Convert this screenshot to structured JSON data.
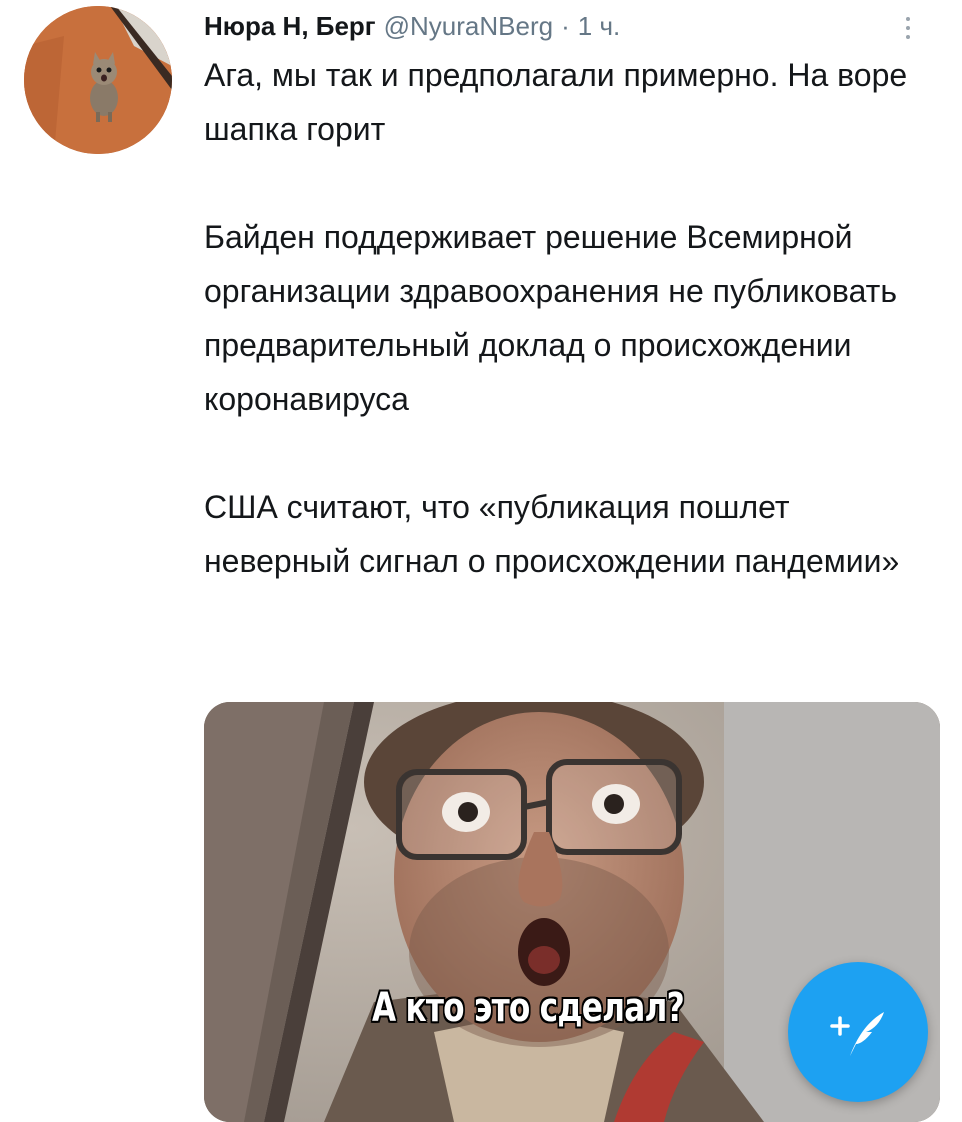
{
  "tweet": {
    "author_name": "Нюра Н, Берг",
    "author_handle": "@NyuraNBerg",
    "separator": "·",
    "time": "1 ч.",
    "paragraphs": [
      "Ага, мы так и предполагали примерно. На воре шапка горит",
      "Байден поддерживает решение Всемирной организации здравоохранения не публиковать предварительный доклад о происхождении коронавируса",
      "США считают, что «публикация пошлет неверный сигнал о происхождении пандемии»"
    ],
    "media_caption": "А кто это сделал?"
  },
  "icons": {
    "more": "more-vertical-icon",
    "compose": "compose-tweet-icon"
  },
  "colors": {
    "accent": "#1da1f2",
    "text": "#14171a",
    "muted": "#657786"
  }
}
